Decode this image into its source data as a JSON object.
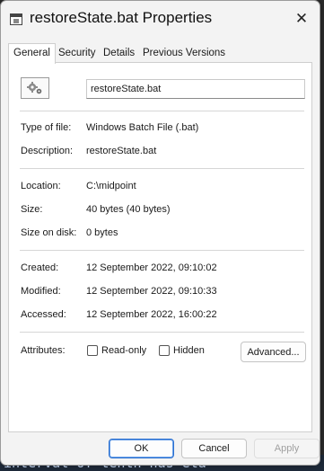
{
  "window": {
    "title": "restoreState.bat Properties",
    "close_glyph": "✕"
  },
  "tabs": [
    {
      "label": "General",
      "active": true
    },
    {
      "label": "Security",
      "active": false
    },
    {
      "label": "Details",
      "active": false
    },
    {
      "label": "Previous Versions",
      "active": false
    }
  ],
  "general": {
    "file_icon": "gears-icon",
    "file_name": "restoreState.bat",
    "type_label": "Type of file:",
    "type_value": "Windows Batch File (.bat)",
    "description_label": "Description:",
    "description_value": "restoreState.bat",
    "location_label": "Location:",
    "location_value": "C:\\midpoint",
    "size_label": "Size:",
    "size_value": "40 bytes (40 bytes)",
    "size_on_disk_label": "Size on disk:",
    "size_on_disk_value": "0 bytes",
    "created_label": "Created:",
    "created_value": "12 September 2022, 09:10:02",
    "modified_label": "Modified:",
    "modified_value": "12 September 2022, 09:10:33",
    "accessed_label": "Accessed:",
    "accessed_value": "12 September 2022, 16:00:22",
    "attributes_label": "Attributes:",
    "readonly_label": "Read-only",
    "readonly_checked": false,
    "hidden_label": "Hidden",
    "hidden_checked": false,
    "advanced_label": "Advanced..."
  },
  "footer": {
    "ok_label": "OK",
    "cancel_label": "Cancel",
    "apply_label": "Apply"
  },
  "background": {
    "terminal_text": "interval of tenth has eta"
  },
  "colors": {
    "window_bg": "#f3f3f3",
    "panel_bg": "#ffffff",
    "ok_border": "#2a6fd0"
  }
}
